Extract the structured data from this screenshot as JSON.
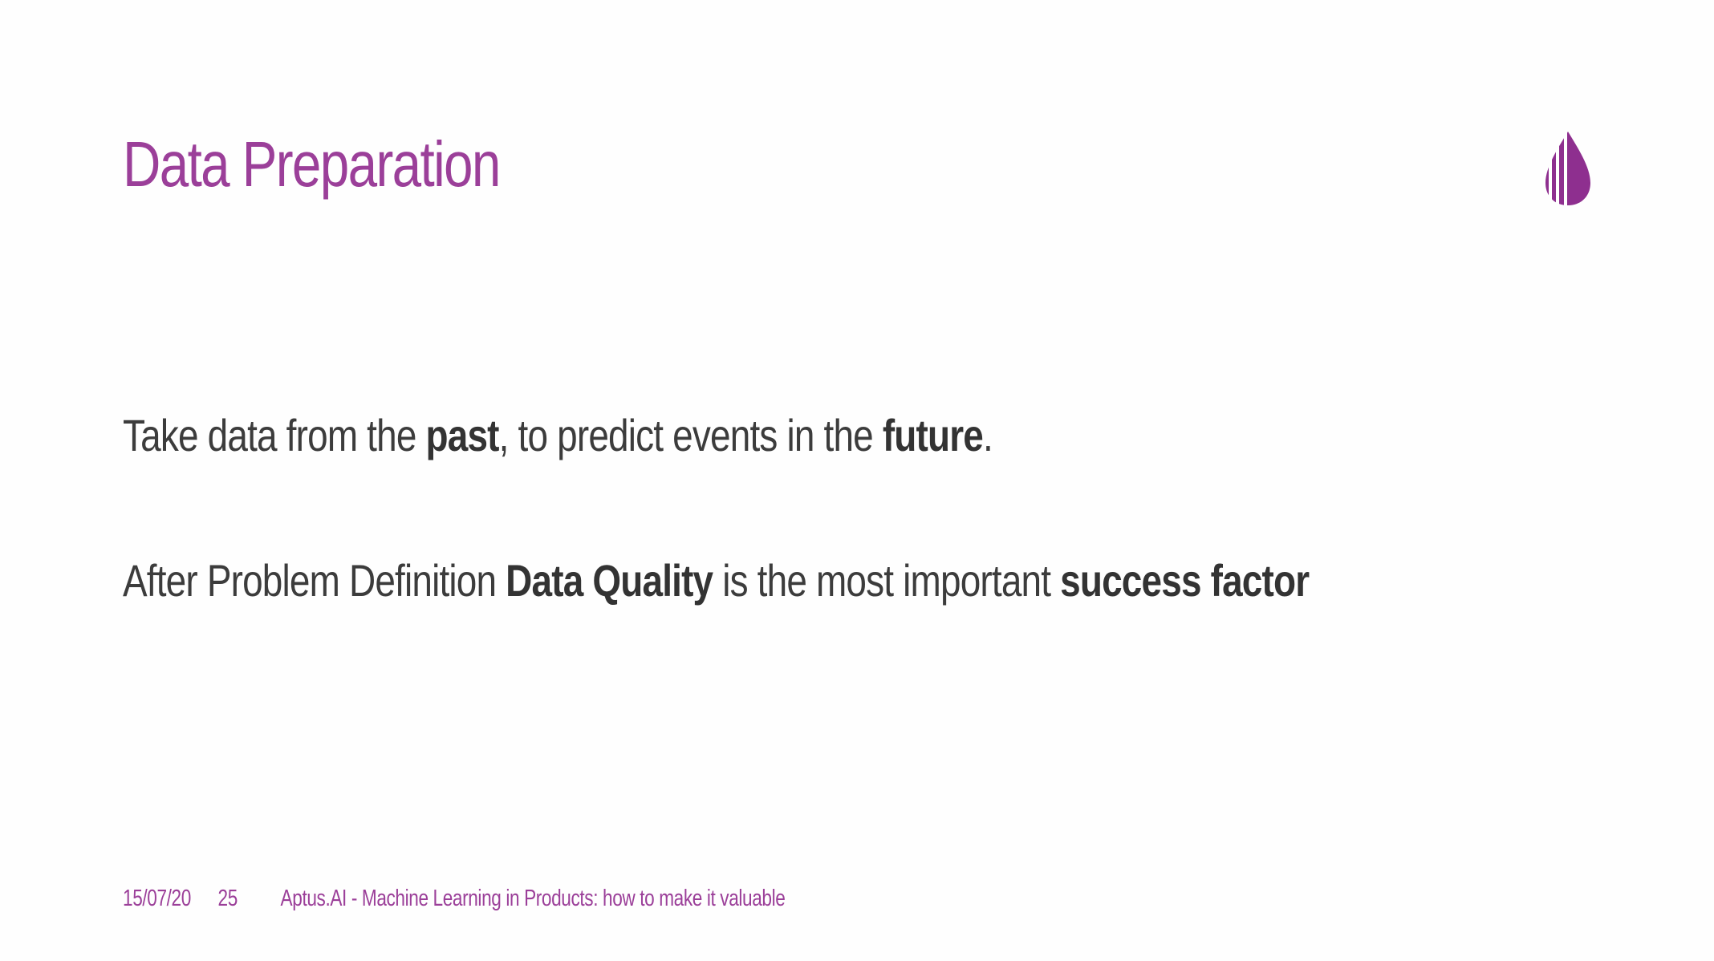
{
  "slide": {
    "title": "Data Preparation",
    "line1": {
      "t1": "Take data from the ",
      "b1": "past",
      "t2": ", to predict events in the ",
      "b2": "future",
      "t3": "."
    },
    "line2": {
      "t1": "After Problem Definition ",
      "b1": "Data Quality",
      "t2": " is the most important ",
      "b2": "success factor"
    }
  },
  "footer": {
    "date": "15/07/20",
    "page": "25",
    "caption": "Aptus.AI - Machine Learning in Products: how to make it valuable"
  },
  "logo": {
    "icon": "droplet-icon",
    "color": "#8e2f8f"
  },
  "colors": {
    "accent": "#9b3f99",
    "text": "#3c3c3c",
    "background": "#fefefe"
  }
}
